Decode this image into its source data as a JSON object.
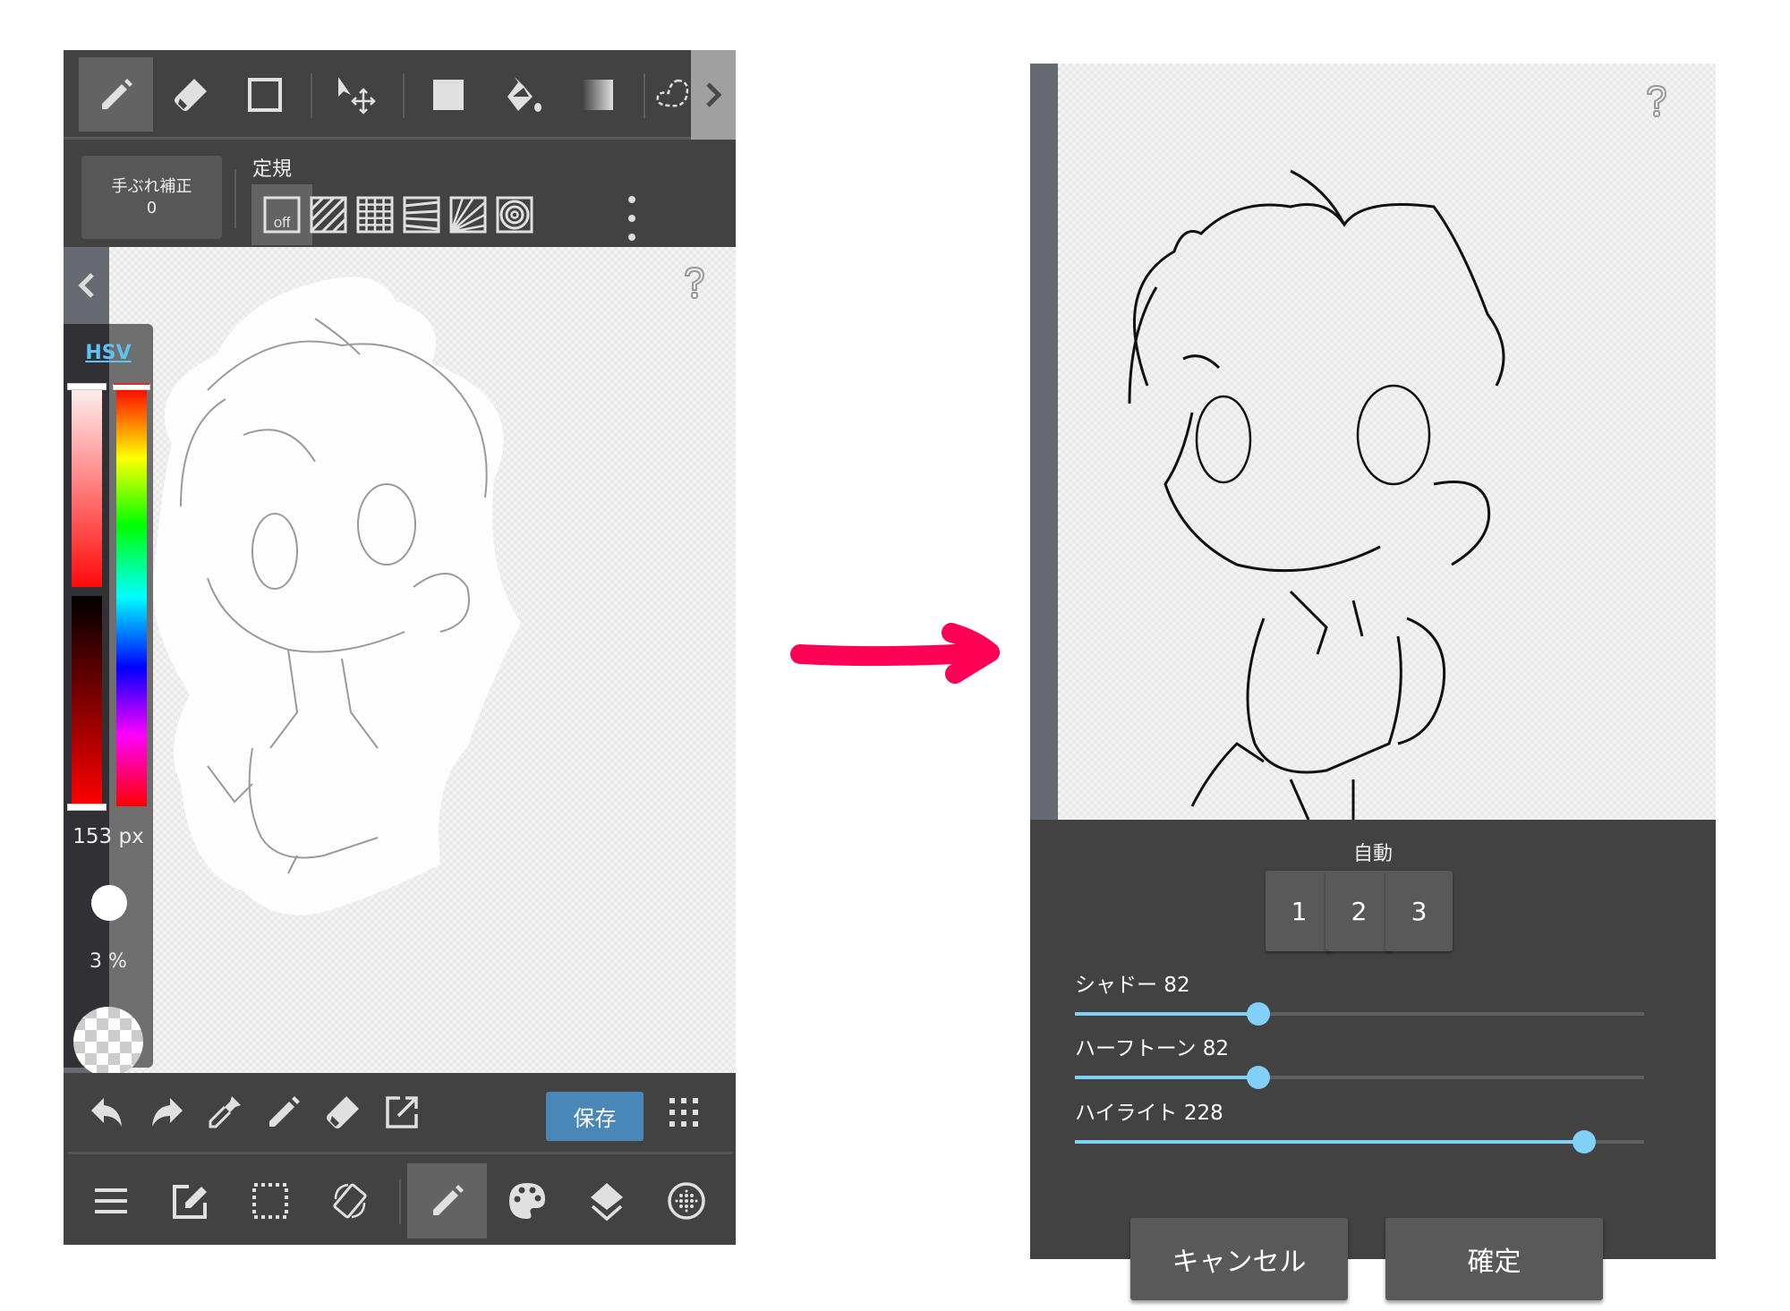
{
  "left_screen": {
    "top_toolbar": {
      "tools": [
        {
          "name": "pen",
          "icon": "pencil-icon",
          "active": true
        },
        {
          "name": "eraser",
          "icon": "eraser-icon",
          "active": false
        },
        {
          "name": "shape",
          "icon": "rectangle-outline-icon",
          "active": false
        },
        {
          "name": "move",
          "icon": "move-cursor-icon",
          "active": false
        },
        {
          "name": "fill-rect",
          "icon": "filled-rectangle-icon",
          "active": false
        },
        {
          "name": "bucket",
          "icon": "paint-bucket-icon",
          "active": false
        },
        {
          "name": "gradient",
          "icon": "gradient-icon",
          "active": false
        },
        {
          "name": "lasso",
          "icon": "lasso-icon",
          "active": false
        }
      ],
      "scroll_icon": "chevron-right-icon"
    },
    "stabilizer": {
      "label": "手ぶれ補正",
      "value": "0"
    },
    "ruler": {
      "title": "定規",
      "off_label": "off",
      "options": [
        "off",
        "parallel",
        "grid",
        "perspective-lines",
        "radial",
        "concentric"
      ],
      "selected": "off"
    },
    "color_panel": {
      "mode_label": "HSV",
      "brush_size": "153 px",
      "opacity": "3 %",
      "hue_slider": 0.0,
      "saturation_slider": 0.0,
      "value_slider": 1.0,
      "current_color": "#ff0000"
    },
    "help_icon": "question-icon",
    "action_bar": {
      "save_label": "保存",
      "save_color": "#4a87b9",
      "icons": [
        "undo-icon",
        "redo-icon",
        "eyedropper-icon",
        "pencil-icon",
        "eraser-icon",
        "export-icon",
        "grid-menu-icon"
      ]
    },
    "nav_bar": {
      "icons": [
        "menu-icon",
        "edit-icon",
        "selection-icon",
        "rotate-canvas-icon",
        "brush-icon",
        "palette-icon",
        "layers-icon",
        "material-icon"
      ],
      "active": "brush-icon"
    }
  },
  "arrow": {
    "color": "#ff0055"
  },
  "right_screen": {
    "help_icon": "question-icon",
    "dialog": {
      "auto_label": "自動",
      "presets": [
        "1",
        "2",
        "3"
      ],
      "sliders": [
        {
          "name": "shadow",
          "label": "シャドー 82",
          "value": 82,
          "max": 255
        },
        {
          "name": "halftone",
          "label": "ハーフトーン 82",
          "value": 82,
          "max": 255
        },
        {
          "name": "highlight",
          "label": "ハイライト 228",
          "value": 228,
          "max": 255
        }
      ],
      "cancel_label": "キャンセル",
      "confirm_label": "確定",
      "accent_color": "#80d0f7"
    }
  }
}
